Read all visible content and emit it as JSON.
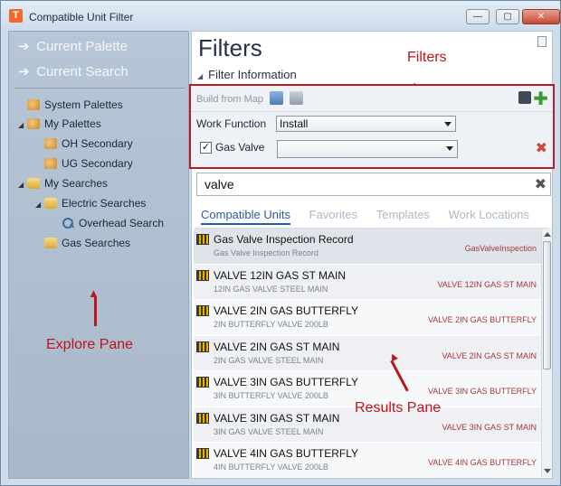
{
  "window": {
    "app_icon_letter": "T",
    "title": "Compatible Unit Filter",
    "minimize_glyph": "—",
    "maximize_glyph": "▢",
    "close_glyph": "✕"
  },
  "explore_pane": {
    "nav": [
      {
        "label": "Current Palette",
        "icon": "arrow-right-icon"
      },
      {
        "label": "Current Search",
        "icon": "arrow-right-icon"
      }
    ],
    "tree": [
      {
        "label": "System Palettes",
        "icon": "palette-icon",
        "expander": ""
      },
      {
        "label": "My Palettes",
        "icon": "palette-icon",
        "expander": "◢"
      },
      {
        "label": "OH Secondary",
        "icon": "palette-icon",
        "expander": ""
      },
      {
        "label": "UG Secondary",
        "icon": "palette-icon",
        "expander": ""
      },
      {
        "label": "My Searches",
        "icon": "folder-icon",
        "expander": "◢"
      },
      {
        "label": "Electric Searches",
        "icon": "folder-icon",
        "expander": "◢"
      },
      {
        "label": "Overhead Search",
        "icon": "magnifier-icon",
        "expander": ""
      },
      {
        "label": "Gas Searches",
        "icon": "folder-icon",
        "expander": ""
      }
    ],
    "annotation": "Explore Pane"
  },
  "filters_panel": {
    "title": "Filters",
    "section_toggle": "◢",
    "section_label": "Filter Information",
    "annotation": "Filters",
    "build_from_map": "Build from Map",
    "add_glyph": "✚",
    "work_function": {
      "label": "Work Function",
      "value": "Install"
    },
    "gas_valve": {
      "label": "Gas Valve",
      "checked": true,
      "check_glyph": "✓",
      "value": "",
      "remove_glyph": "✖"
    },
    "search": {
      "value": "valve",
      "clear_glyph": "✖"
    },
    "tabs": [
      {
        "label": "Compatible Units",
        "active": true
      },
      {
        "label": "Favorites",
        "active": false
      },
      {
        "label": "Templates",
        "active": false
      },
      {
        "label": "Work Locations",
        "active": false
      }
    ],
    "results": [
      {
        "title": "Gas Valve Inspection Record",
        "subtitle": "Gas Valve Inspection Record",
        "code": "GasValveInspection"
      },
      {
        "title": "VALVE 12IN GAS ST MAIN",
        "subtitle": "12IN GAS VALVE STEEL MAIN",
        "code": "VALVE 12IN GAS ST MAIN"
      },
      {
        "title": "VALVE 2IN GAS BUTTERFLY",
        "subtitle": "2IN BUTTERFLY VALVE 200LB",
        "code": "VALVE 2IN GAS BUTTERFLY"
      },
      {
        "title": "VALVE 2IN GAS ST MAIN",
        "subtitle": "2IN GAS VALVE STEEL MAIN",
        "code": "VALVE 2IN GAS ST MAIN"
      },
      {
        "title": "VALVE 3IN GAS BUTTERFLY",
        "subtitle": "3IN BUTTERFLY VALVE 200LB",
        "code": "VALVE 3IN GAS BUTTERFLY"
      },
      {
        "title": "VALVE 3IN GAS ST MAIN",
        "subtitle": "3IN GAS VALVE STEEL MAIN",
        "code": "VALVE 3IN GAS ST MAIN"
      },
      {
        "title": "VALVE 4IN GAS BUTTERFLY",
        "subtitle": "4IN BUTTERFLY VALVE 200LB",
        "code": "VALVE 4IN GAS BUTTERFLY"
      }
    ],
    "results_annotation": "Results Pane"
  },
  "colors": {
    "annotation_red": "#c0141b",
    "active_tab": "#2a5d9f",
    "add_green": "#2f9e2f"
  }
}
